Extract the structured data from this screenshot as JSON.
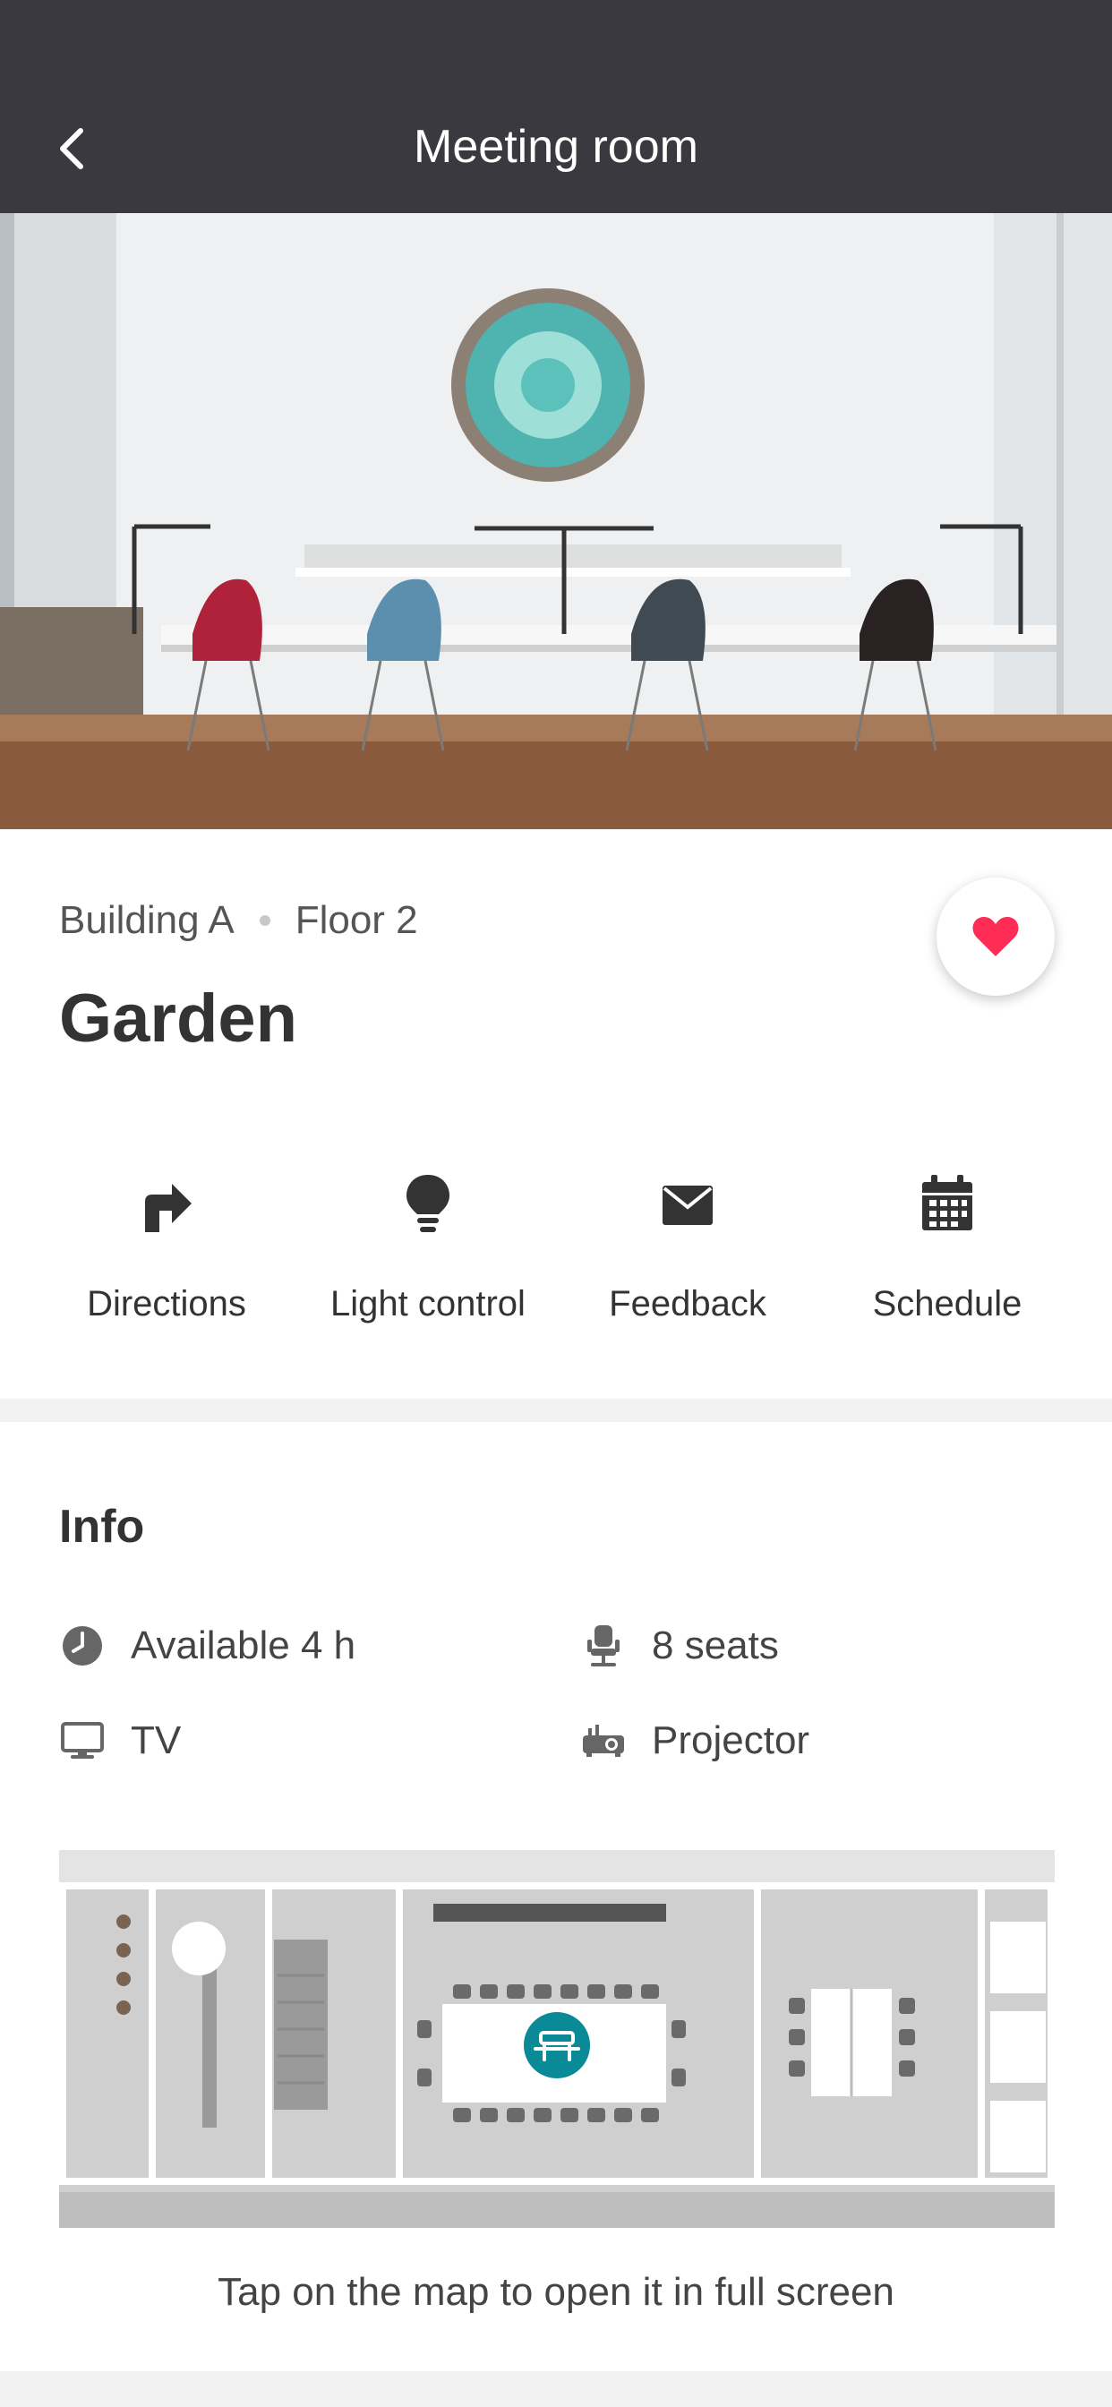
{
  "header": {
    "title": "Meeting room",
    "back_icon": "chevron-left-icon"
  },
  "hero": {
    "description_icon": "room-photo"
  },
  "room": {
    "building": "Building A",
    "floor": "Floor 2",
    "name": "Garden",
    "favorite": true
  },
  "actions": [
    {
      "label": "Directions",
      "icon": "turn-right-arrow-icon"
    },
    {
      "label": "Light control",
      "icon": "lightbulb-icon"
    },
    {
      "label": "Feedback",
      "icon": "envelope-icon"
    },
    {
      "label": "Schedule",
      "icon": "calendar-icon"
    }
  ],
  "info": {
    "title": "Info",
    "features": [
      {
        "label": "Available 4 h",
        "icon": "clock-icon"
      },
      {
        "label": "8 seats",
        "icon": "chair-icon"
      },
      {
        "label": "TV",
        "icon": "monitor-icon"
      },
      {
        "label": "Projector",
        "icon": "projector-icon"
      }
    ]
  },
  "map": {
    "hint": "Tap on the map to open it in full screen"
  },
  "colors": {
    "topbar": "#3a393f",
    "accent": "#ff2d55",
    "map_marker": "#0a8a96"
  }
}
